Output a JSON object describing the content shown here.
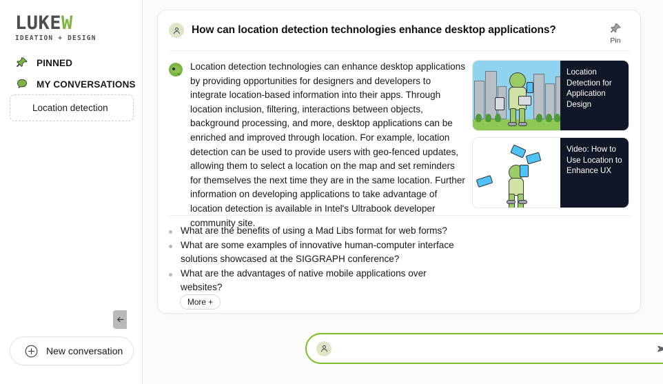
{
  "sidebar": {
    "logo": {
      "word_dark": "LUKE",
      "word_green": "W",
      "tagline": "IDEATION + DESIGN"
    },
    "nav": [
      {
        "label": "PINNED",
        "icon": "pin-icon"
      },
      {
        "label": "MY CONVERSATIONS",
        "icon": "speech-bubble-icon"
      }
    ],
    "conversations": [
      {
        "label": "Location detection"
      }
    ],
    "new_conversation_label": "New conversation",
    "collapse_icon": "arrow-left-icon"
  },
  "conversation": {
    "question": "How can location detection technologies enhance desktop applications?",
    "pin_label": "Pin",
    "answer": "Location detection technologies can enhance desktop applications by providing opportunities for designers and developers to integrate location-based information into their apps. Through location inclusion, filtering, interactions between objects, background processing, and more, desktop applications can be enriched and improved through location. For example, location detection can be used to provide users with geo-fenced updates, allowing them to select a location on the map and set reminders for themselves the next time they are in the same location. Further information on developing applications to take advantage of location detection is available in Intel's Ultrabook developer community site.",
    "media": [
      {
        "caption": "Location Detection for Application Design",
        "thumb": "city-illustration"
      },
      {
        "caption": "Video: How to Use Location to Enhance UX",
        "thumb": "juggling-illustration"
      }
    ],
    "suggestions": [
      "What are the benefits of using a Mad Libs format for web forms?",
      "What are some examples of innovative human-computer interface solutions showcased at the SIGGRAPH conference?",
      "What are the advantages of native mobile applications over websites?"
    ],
    "more_label": "More +"
  },
  "composer": {
    "value": "",
    "placeholder": "",
    "send_icon": "send-paper-plane-icon",
    "avatar_icon": "user-avatar-icon"
  },
  "colors": {
    "brand_green": "#80b440",
    "accent_green": "#7cc025",
    "dark_panel": "#101827",
    "logo_dark": "#4a4e52"
  }
}
